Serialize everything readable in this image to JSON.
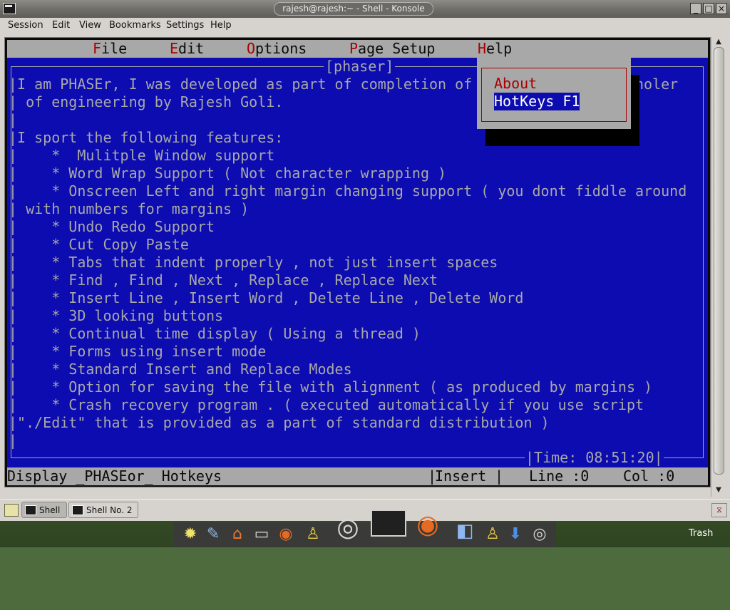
{
  "window": {
    "title": "rajesh@rajesh:~ - Shell - Konsole",
    "menu": [
      "Session",
      "Edit",
      "View",
      "Bookmarks",
      "Settings",
      "Help"
    ]
  },
  "app": {
    "menubar": [
      {
        "hotkey": "F",
        "rest": "ile"
      },
      {
        "hotkey": "E",
        "rest": "dit"
      },
      {
        "hotkey": "O",
        "rest": "ptions"
      },
      {
        "hotkey": "P",
        "rest": "age Setup"
      },
      {
        "hotkey": "H",
        "rest": "elp"
      }
    ],
    "border_title": "[phaser]",
    "lines": [
      "|I am PHASEr, I was developed as part of completion of my project for Bacholer",
      "| of engineering by Rajesh Goli.",
      "|",
      "|I sport the following features:",
      "|    *  Mulitple Window support",
      "|    * Word Wrap Support ( Not character wrapping )",
      "|    * Onscreen Left and right margin changing support ( you dont fiddle around",
      "| with numbers for margins )",
      "|    * Undo Redo Support",
      "|    * Cut Copy Paste",
      "|    * Tabs that indent properly , not just insert spaces",
      "|    * Find , Find , Next , Replace , Replace Next",
      "|    * Insert Line , Insert Word , Delete Line , Delete Word",
      "|    * 3D looking buttons",
      "|    * Continual time display ( Using a thread )",
      "|    * Forms using insert mode",
      "|    * Standard Insert and Replace Modes",
      "|    * Option for saving the file with alignment ( as produced by margins )",
      "|    * Crash recovery program . ( executed automatically if you use script",
      "|\"./Edit\" that is provided as a part of standard distribution )",
      "|"
    ],
    "time": "Time: 08:51:20",
    "help_menu": [
      "About",
      "HotKeys F1"
    ],
    "status": {
      "left": "Display _PHASEor_ Hotkeys",
      "mode": "Insert",
      "line": "Line :0",
      "col": "Col :0"
    }
  },
  "taskbar": {
    "tasks": [
      "Shell",
      "Shell No. 2"
    ]
  },
  "dock": {
    "icons": [
      "settings-icon",
      "editor-icon",
      "home-icon",
      "terminal-icon",
      "firefox-icon",
      "user-icon",
      "cd-icon",
      "terminal-large-icon",
      "firefox-large-icon",
      "files-icon",
      "user-small-icon",
      "download-icon",
      "cd-small-icon"
    ],
    "trash_label": "Trash"
  }
}
